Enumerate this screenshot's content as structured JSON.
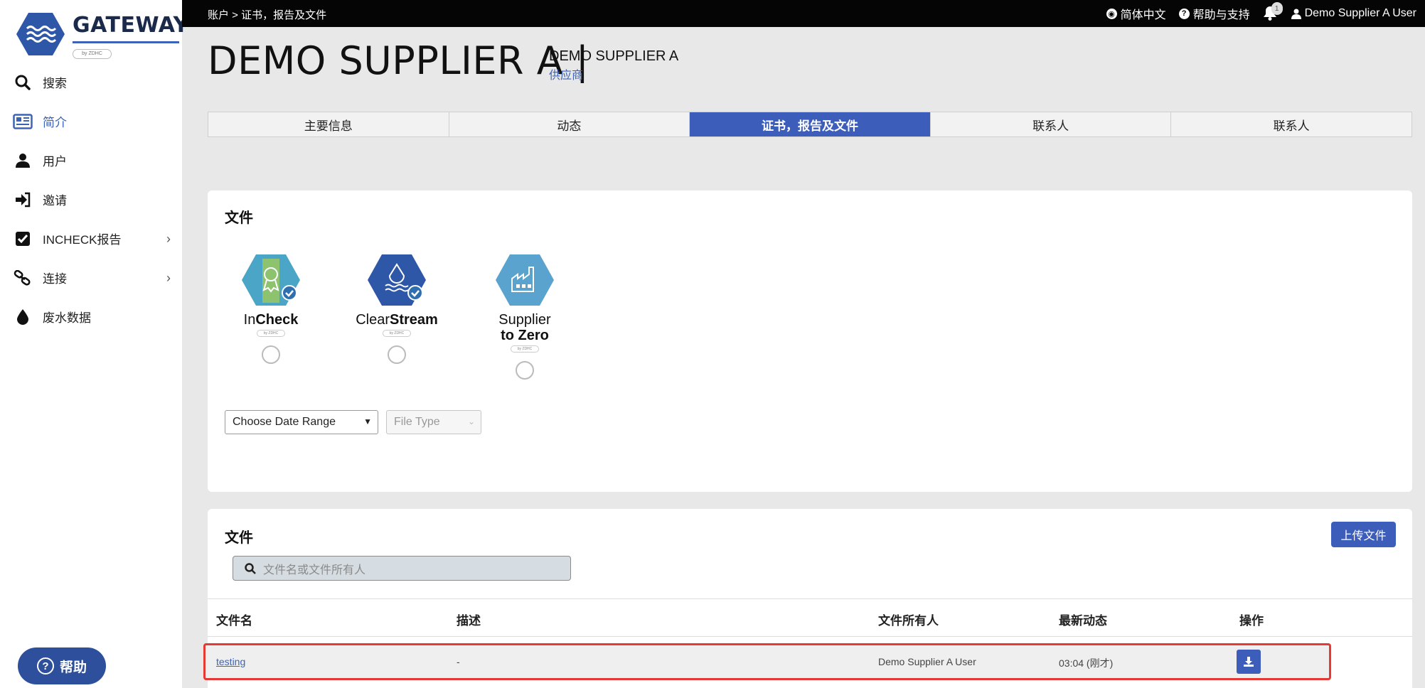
{
  "logo": {
    "brand": "GATEWAY",
    "tag": "by ZDHC"
  },
  "sidebar": {
    "items": [
      {
        "label": "搜索",
        "icon": "search-icon"
      },
      {
        "label": "简介",
        "icon": "profile-card-icon"
      },
      {
        "label": "用户",
        "icon": "user-icon"
      },
      {
        "label": "邀请",
        "icon": "sign-in-icon"
      },
      {
        "label": "INCHECK报告",
        "icon": "checkbox-icon"
      },
      {
        "label": "连接",
        "icon": "link-icon"
      },
      {
        "label": "废水数据",
        "icon": "water-drop-icon"
      }
    ],
    "help_label": "帮助"
  },
  "topbar": {
    "breadcrumb": "账户 > 证书，报告及文件",
    "language": "简体中文",
    "help": "帮助与支持",
    "notifications": "1",
    "user": "Demo Supplier A User"
  },
  "header": {
    "company": "DEMO SUPPLIER A |",
    "company_sub": "DEMO SUPPLIER A",
    "role": "供应商"
  },
  "tabs": [
    {
      "label": "主要信息"
    },
    {
      "label": "动态"
    },
    {
      "label": "证书，报告及文件"
    },
    {
      "label": "联系人"
    },
    {
      "label": "联系人"
    }
  ],
  "files_filter": {
    "title": "文件",
    "badges": [
      {
        "prefix": "In",
        "bold": "Check",
        "tag": "by ZDHC"
      },
      {
        "prefix": "Clear",
        "bold": "Stream",
        "tag": "by ZDHC"
      },
      {
        "line1": "Supplier",
        "line2": "to Zero",
        "tag": "by ZDHC"
      }
    ],
    "date_range": "Choose Date Range",
    "file_type": "File Type"
  },
  "files_list": {
    "title": "文件",
    "upload_label": "上传文件",
    "search_placeholder": "文件名或文件所有人",
    "columns": [
      "文件名",
      "描述",
      "文件所有人",
      "最新动态",
      "操作"
    ],
    "rows": [
      {
        "name": "testing",
        "description": "-",
        "owner": "Demo Supplier A User",
        "updated": "03:04 (刚才)"
      }
    ]
  },
  "colors": {
    "accent": "#3d5dba",
    "highlight": "#e53935"
  }
}
